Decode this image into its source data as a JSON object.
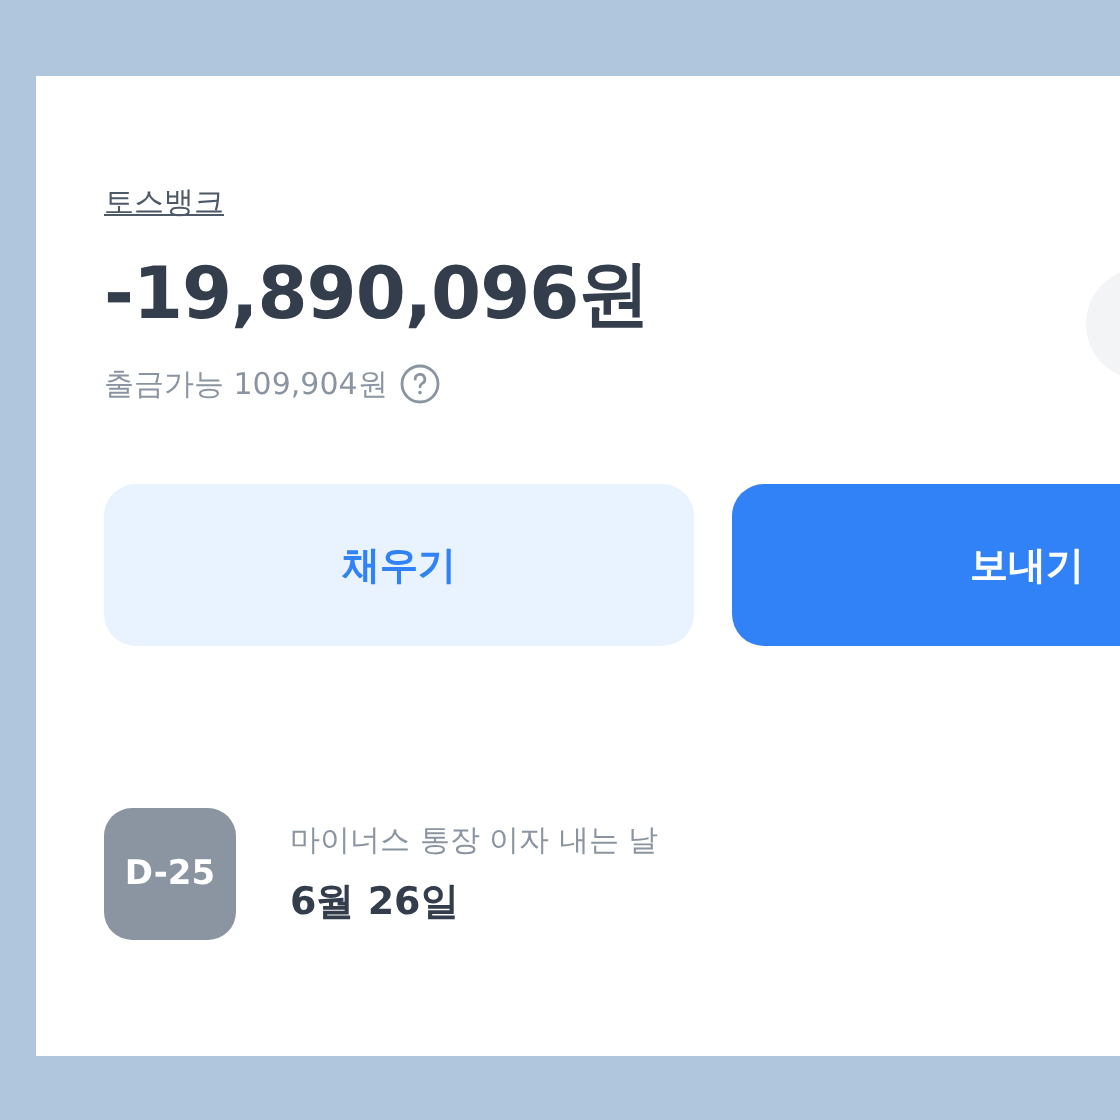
{
  "account": {
    "bank": "토스뱅크",
    "balance": "-19,890,096원",
    "available": "출금가능 109,904원"
  },
  "buttons": [
    {
      "label": "채우기",
      "kind": "secondary"
    },
    {
      "label": "보내기",
      "kind": "primary"
    }
  ],
  "schedule": {
    "badge": "D-25",
    "title": "마이너스 통장 이자 내는 날",
    "date": "6월 26일"
  }
}
